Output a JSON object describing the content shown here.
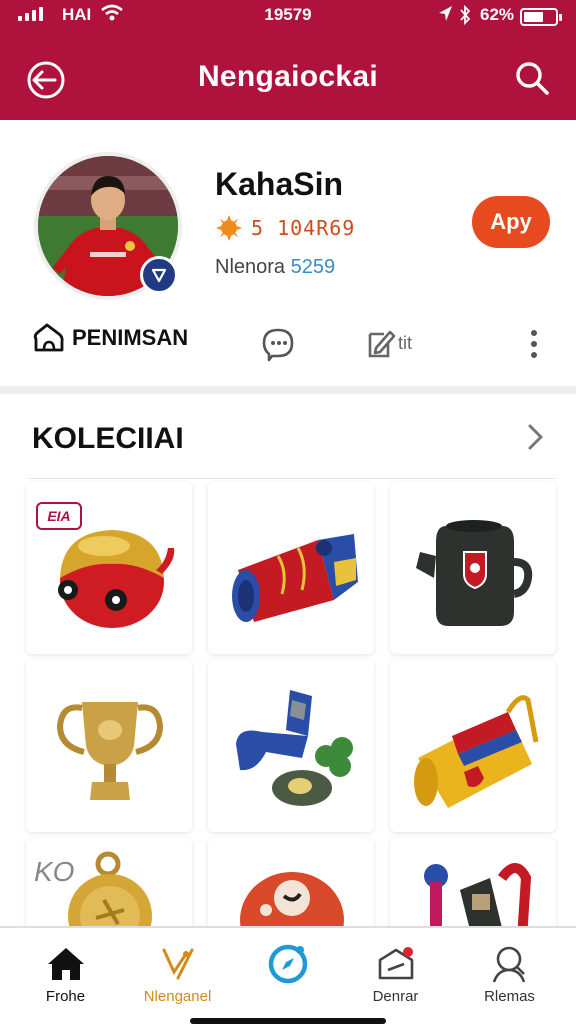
{
  "status_bar": {
    "carrier": "HAI",
    "time": "19579",
    "battery": "62%",
    "battery_level": 0.62
  },
  "header": {
    "title": "Nengaiockai",
    "back_icon": "back-arrow-icon",
    "search_icon": "search-icon"
  },
  "profile": {
    "name": "KahaSin",
    "points": "5 104R69",
    "points_icon": "sun-badge-icon",
    "members_label": "Nlenora",
    "members_value": "5259",
    "add_button": "Apy",
    "verified_icon": "verified-shield-icon"
  },
  "actions": {
    "primary_label": "PENIMSAN",
    "primary_icon": "cloud-home-icon",
    "chat_icon": "chat-icon",
    "edit_label": "tit",
    "edit_icon": "edit-icon",
    "more_icon": "more-vertical-icon"
  },
  "collection": {
    "title": "KOLECIIAI",
    "arrow_icon": "chevron-right-icon",
    "items": [
      {
        "name": "red-gold-ball-item",
        "badge": "EIA"
      },
      {
        "name": "red-blue-scarf-item"
      },
      {
        "name": "black-kettle-item"
      },
      {
        "name": "gold-trophy-item"
      },
      {
        "name": "blue-clover-item"
      },
      {
        "name": "yellow-banner-item"
      },
      {
        "name": "gold-medal-item",
        "tag": "KO"
      },
      {
        "name": "red-ball-item"
      },
      {
        "name": "scarf-mix-item"
      }
    ]
  },
  "tabbar": {
    "tabs": [
      {
        "label": "Frohe",
        "icon": "home-icon"
      },
      {
        "label": "Nlenganel",
        "icon": "bolt-icon"
      },
      {
        "label": "",
        "icon": "compass-icon"
      },
      {
        "label": "Denrar",
        "icon": "inbox-icon"
      },
      {
        "label": "Rlemas",
        "icon": "profile-icon"
      }
    ]
  },
  "colors": {
    "brand": "#b0123e",
    "accent": "#e64a1e",
    "link": "#3d8bc4"
  }
}
